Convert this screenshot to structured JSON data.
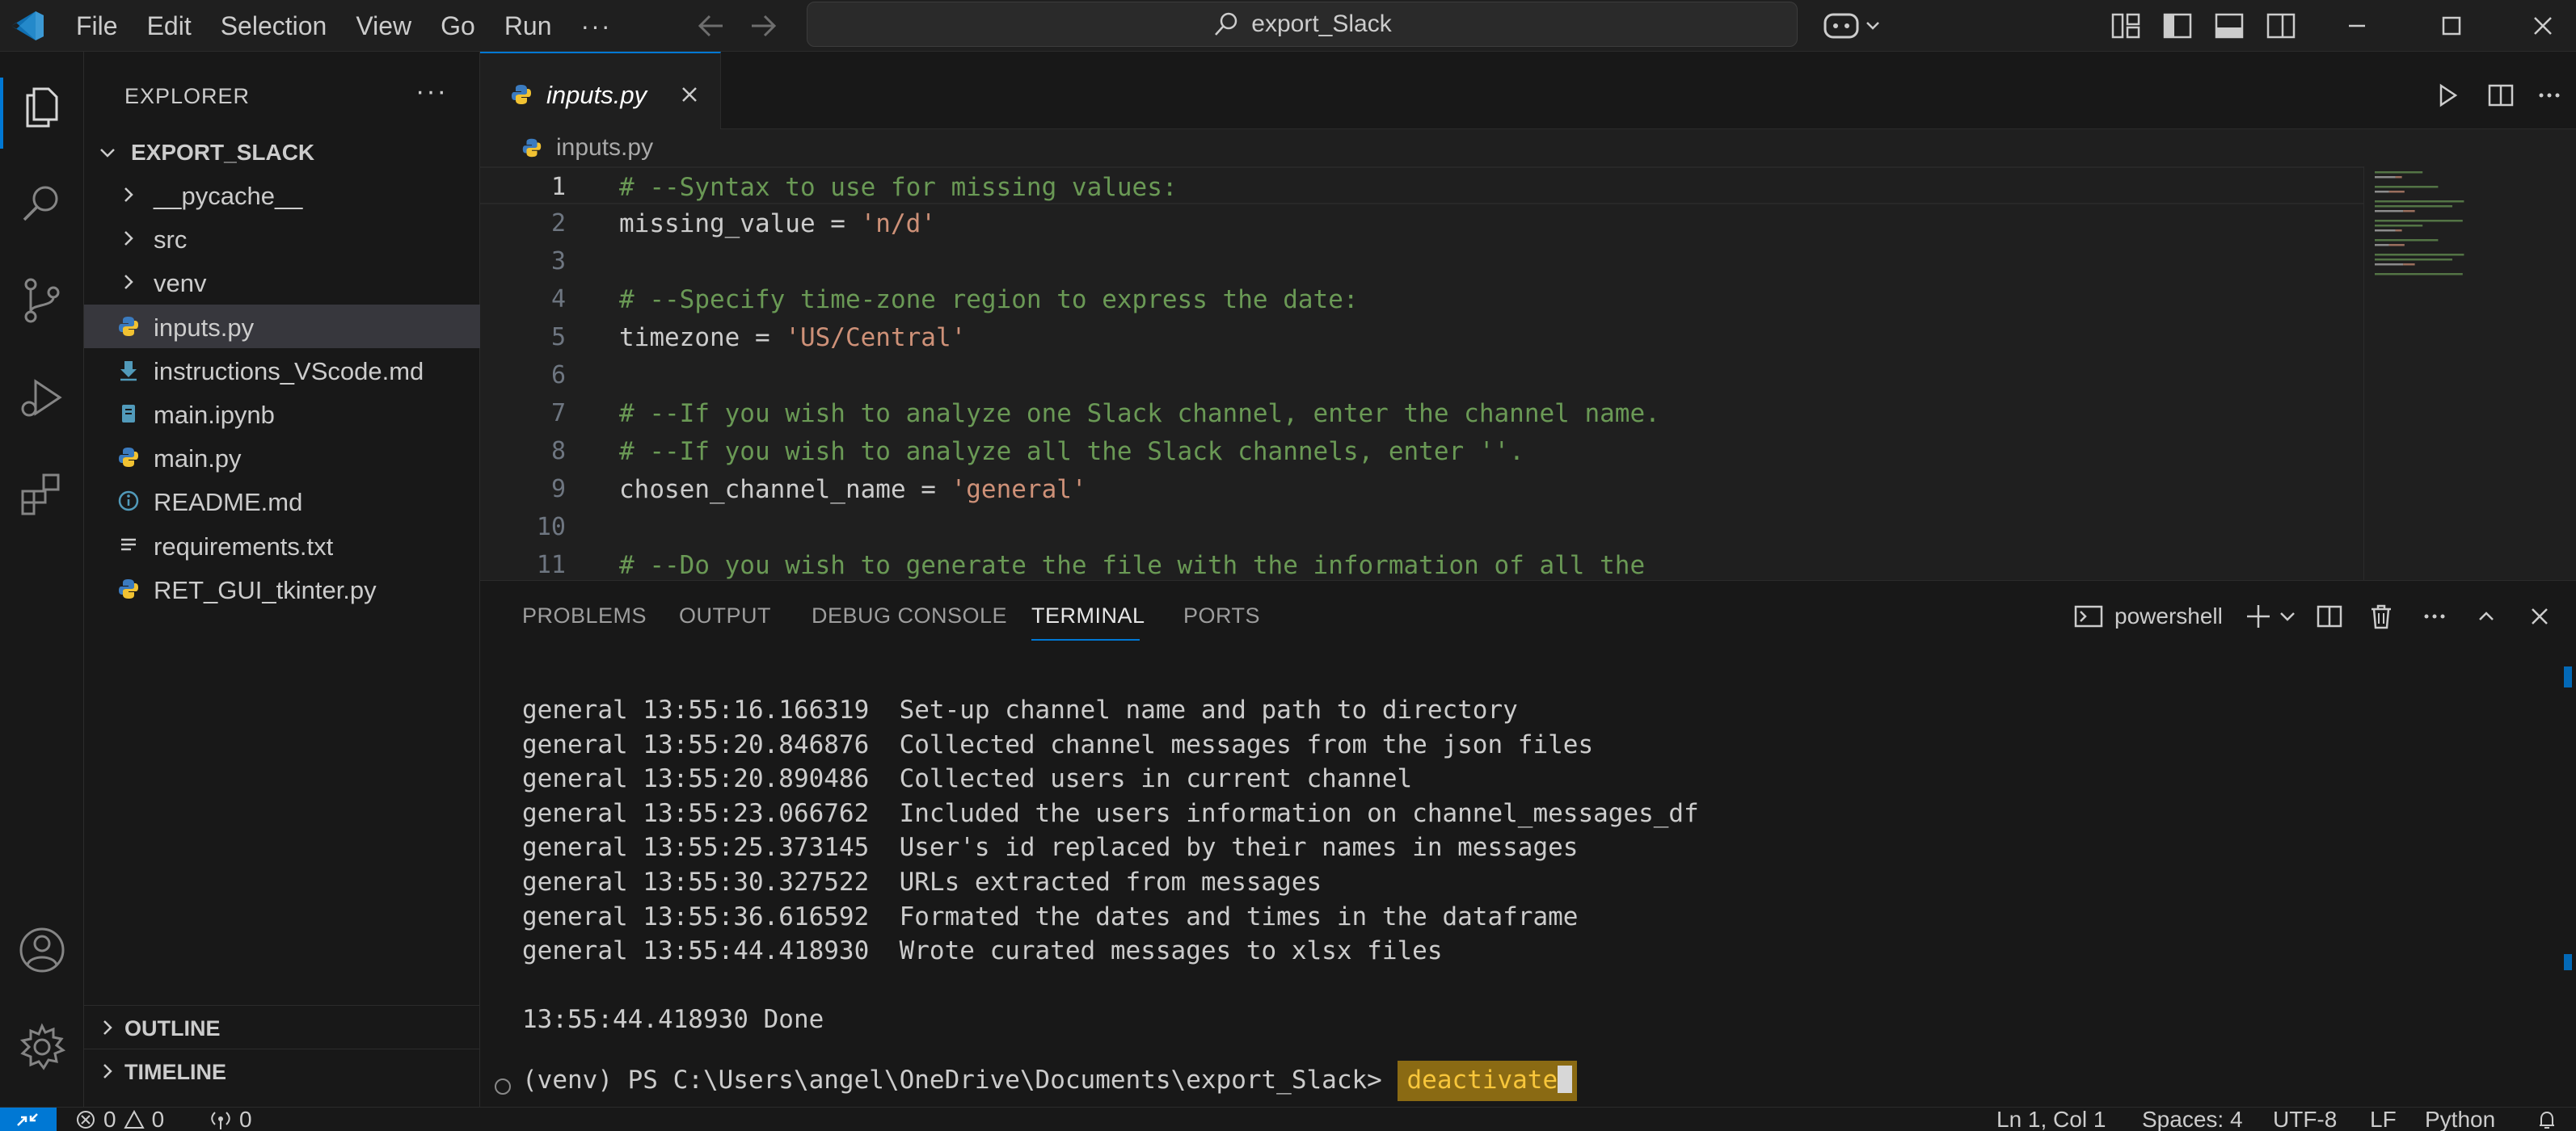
{
  "titlebar": {
    "menu": [
      "File",
      "Edit",
      "Selection",
      "View",
      "Go",
      "Run"
    ],
    "more": "···",
    "search": "export_Slack"
  },
  "sidebar": {
    "title": "EXPLORER",
    "more": "···",
    "folder": "EXPORT_SLACK",
    "items": [
      {
        "label": "__pycache__",
        "type": "folder"
      },
      {
        "label": "src",
        "type": "folder"
      },
      {
        "label": "venv",
        "type": "folder"
      },
      {
        "label": "inputs.py",
        "type": "python",
        "selected": true
      },
      {
        "label": "instructions_VScode.md",
        "type": "markdown-download"
      },
      {
        "label": "main.ipynb",
        "type": "notebook"
      },
      {
        "label": "main.py",
        "type": "python"
      },
      {
        "label": "README.md",
        "type": "info"
      },
      {
        "label": "requirements.txt",
        "type": "text"
      },
      {
        "label": "RET_GUI_tkinter.py",
        "type": "python"
      }
    ],
    "sections": [
      "OUTLINE",
      "TIMELINE"
    ]
  },
  "editor": {
    "tab": "inputs.py",
    "breadcrumb": "inputs.py",
    "lines": [
      {
        "n": "1",
        "tokens": [
          [
            "comment",
            "# --Syntax to use for missing values:"
          ]
        ]
      },
      {
        "n": "2",
        "tokens": [
          [
            "plain",
            "missing_value = "
          ],
          [
            "string",
            "'n/d'"
          ]
        ]
      },
      {
        "n": "3",
        "tokens": []
      },
      {
        "n": "4",
        "tokens": [
          [
            "comment",
            "# --Specify time-zone region to express the date:"
          ]
        ]
      },
      {
        "n": "5",
        "tokens": [
          [
            "plain",
            "timezone = "
          ],
          [
            "string",
            "'US/Central'"
          ]
        ]
      },
      {
        "n": "6",
        "tokens": []
      },
      {
        "n": "7",
        "tokens": [
          [
            "comment",
            "# --If you wish to analyze one Slack channel, enter the channel name."
          ]
        ]
      },
      {
        "n": "8",
        "tokens": [
          [
            "comment",
            "# --If you wish to analyze all the Slack channels, enter ''."
          ]
        ]
      },
      {
        "n": "9",
        "tokens": [
          [
            "plain",
            "chosen_channel_name = "
          ],
          [
            "string",
            "'general'"
          ]
        ]
      },
      {
        "n": "10",
        "tokens": []
      },
      {
        "n": "11",
        "tokens": [
          [
            "comment",
            "# --Do you wish to generate the file with the information of all the"
          ]
        ]
      }
    ]
  },
  "panel": {
    "tabs": [
      "PROBLEMS",
      "OUTPUT",
      "DEBUG CONSOLE",
      "TERMINAL",
      "PORTS"
    ],
    "active_tab": "TERMINAL",
    "shell": "powershell",
    "terminal_lines": [
      "general 13:55:16.166319  Set-up channel name and path to directory",
      "general 13:55:20.846876  Collected channel messages from the json files",
      "general 13:55:20.890486  Collected users in current channel",
      "general 13:55:23.066762  Included the users information on channel_messages_df",
      "general 13:55:25.373145  User's id replaced by their names in messages",
      "general 13:55:30.327522  URLs extracted from messages",
      "general 13:55:36.616592  Formated the dates and times in the dataframe",
      "general 13:55:44.418930  Wrote curated messages to xlsx files",
      "",
      "13:55:44.418930 Done"
    ],
    "prompt": "(venv) PS C:\\Users\\angel\\OneDrive\\Documents\\export_Slack> ",
    "command": "deactivate"
  },
  "statusbar": {
    "errors": "0",
    "warnings": "0",
    "ports": "0",
    "position": "Ln 1, Col 1",
    "spaces": "Spaces: 4",
    "encoding": "UTF-8",
    "eol": "LF",
    "language": "Python"
  },
  "colors": {
    "accent": "#0078d4",
    "comment": "#6a9955",
    "string": "#ce9178",
    "highlight": "#8a6a13"
  }
}
